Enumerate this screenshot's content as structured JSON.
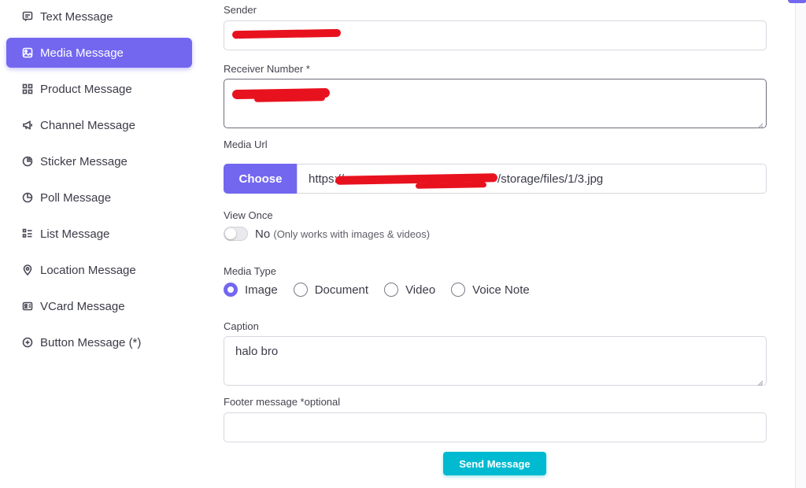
{
  "sidebar": {
    "items": [
      {
        "label": "Text Message",
        "icon": "message-icon"
      },
      {
        "label": "Media Message",
        "icon": "image-icon",
        "active": true
      },
      {
        "label": "Product Message",
        "icon": "grid-icon"
      },
      {
        "label": "Channel Message",
        "icon": "megaphone-icon"
      },
      {
        "label": "Sticker Message",
        "icon": "sticker-icon"
      },
      {
        "label": "Poll Message",
        "icon": "pie-icon"
      },
      {
        "label": "List Message",
        "icon": "list-icon"
      },
      {
        "label": "Location Message",
        "icon": "pin-icon"
      },
      {
        "label": "VCard Message",
        "icon": "vcard-icon"
      },
      {
        "label": "Button Message (*)",
        "icon": "plus-circle-icon"
      }
    ]
  },
  "form": {
    "sender_label": "Sender",
    "receiver_label": "Receiver Number *",
    "media_url_label": "Media Url",
    "choose_label": "Choose",
    "media_url_prefix": "https://",
    "media_url_suffix": "/storage/files/1/3.jpg",
    "view_once_label": "View Once",
    "view_once_value": "No",
    "view_once_note": "(Only works with images & videos)",
    "media_type_label": "Media Type",
    "media_types": [
      {
        "label": "Image",
        "checked": true
      },
      {
        "label": "Document",
        "checked": false
      },
      {
        "label": "Video",
        "checked": false
      },
      {
        "label": "Voice Note",
        "checked": false
      }
    ],
    "caption_label": "Caption",
    "caption_value": "halo bro",
    "footer_label": "Footer message *optional",
    "footer_value": "",
    "send_label": "Send Message"
  },
  "colors": {
    "accent": "#7367f0",
    "send": "#00bad1",
    "redaction": "#e8121f"
  }
}
